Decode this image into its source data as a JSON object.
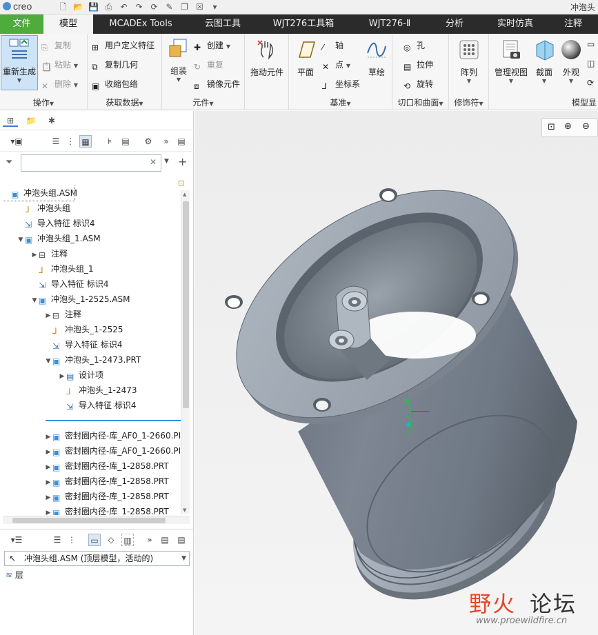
{
  "titlebar": {
    "app_logo": "creo",
    "window_title": "冲泡头"
  },
  "tabs": [
    "文件",
    "模型",
    "MCADEx Tools",
    "云图工具",
    "WJT276工具箱",
    "WJT276-Ⅱ",
    "分析",
    "实时仿真",
    "注释"
  ],
  "ribbon": {
    "operations": {
      "regen": "重新生成",
      "copy": "复制",
      "paste": "粘贴",
      "delete": "删除",
      "label": "操作"
    },
    "get_data": {
      "udf": "用户定义特征",
      "copy_geom": "复制几何",
      "shrinkwrap": "收缩包络",
      "label": "获取数据"
    },
    "component": {
      "assemble": "组装",
      "create": "创建",
      "repeat": "重复",
      "mirror": "镜像元件",
      "label": "元件"
    },
    "drag": {
      "drag": "拖动元件"
    },
    "datum": {
      "plane": "平面",
      "axis": "轴",
      "point": "点",
      "csys": "坐标系",
      "sketch": "草绘",
      "label": "基准"
    },
    "cut_surface": {
      "hole": "孔",
      "extrude": "拉伸",
      "revolve": "旋转",
      "label": "切口和曲面"
    },
    "modifiers": {
      "pattern": "阵列",
      "label": "修饰符"
    },
    "model_display": {
      "manage_views": "管理视图",
      "section": "截面",
      "appearance": "外观",
      "label": "模型显"
    }
  },
  "tree": {
    "items": [
      {
        "label": "冲泡头组.ASM",
        "level": 0,
        "icon": "assembly-icon",
        "toggle": ""
      },
      {
        "label": "冲泡头组",
        "level": 1,
        "icon": "csys-icon",
        "toggle": ""
      },
      {
        "label": "导入特征 标识4",
        "level": 1,
        "icon": "import-feature-icon",
        "toggle": ""
      },
      {
        "label": "冲泡头组_1.ASM",
        "level": 1,
        "icon": "assembly-icon",
        "toggle": "▼"
      },
      {
        "label": "注释",
        "level": 2,
        "icon": "annotation-icon",
        "toggle": "▶"
      },
      {
        "label": "冲泡头组_1",
        "level": 2,
        "icon": "csys-icon",
        "toggle": ""
      },
      {
        "label": "导入特征 标识4",
        "level": 2,
        "icon": "import-feature-icon",
        "toggle": ""
      },
      {
        "label": "冲泡头_1-2525.ASM",
        "level": 2,
        "icon": "assembly-icon",
        "toggle": "▼"
      },
      {
        "label": "注释",
        "level": 3,
        "icon": "annotation-icon",
        "toggle": "▶"
      },
      {
        "label": "冲泡头_1-2525",
        "level": 3,
        "icon": "csys-icon",
        "toggle": ""
      },
      {
        "label": "导入特征 标识4",
        "level": 3,
        "icon": "import-feature-icon",
        "toggle": ""
      },
      {
        "label": "冲泡头_1-2473.PRT",
        "level": 3,
        "icon": "part-icon",
        "toggle": "▼"
      },
      {
        "label": "设计项",
        "level": 4,
        "icon": "design-items-icon",
        "toggle": "▶"
      },
      {
        "label": "冲泡头_1-2473",
        "level": 4,
        "icon": "csys-icon",
        "toggle": ""
      },
      {
        "label": "导入特征 标识4",
        "level": 4,
        "icon": "import-feature-icon",
        "toggle": ""
      },
      {
        "label": "",
        "level": 3,
        "icon": "",
        "toggle": ""
      },
      {
        "label": "密封圈内径-库_AF0_1-2660.PI",
        "level": 3,
        "icon": "part-icon",
        "toggle": "▶"
      },
      {
        "label": "密封圈内径-库_AF0_1-2660.PI",
        "level": 3,
        "icon": "part-icon",
        "toggle": "▶"
      },
      {
        "label": "密封圈内径-库_1-2858.PRT",
        "level": 3,
        "icon": "part-icon",
        "toggle": "▶"
      },
      {
        "label": "密封圈内径-库_1-2858.PRT",
        "level": 3,
        "icon": "part-icon",
        "toggle": "▶"
      },
      {
        "label": "密封圈内径-库_1-2858.PRT",
        "level": 3,
        "icon": "part-icon",
        "toggle": "▶"
      },
      {
        "label": "密封圈内径-库_1-2858.PRT",
        "level": 3,
        "icon": "part-icon",
        "toggle": "▶"
      }
    ]
  },
  "model_selector": "冲泡头组.ASM (顶层模型，活动的)",
  "layers_label": "层",
  "watermark": {
    "cn_red": "野火",
    "cn_dark": "论坛",
    "url": "www.proewildfire.cn"
  },
  "colors": {
    "file_tab": "#4eab3c",
    "tab_bar": "#2b2b2b",
    "accent": "#3a7bd5"
  }
}
